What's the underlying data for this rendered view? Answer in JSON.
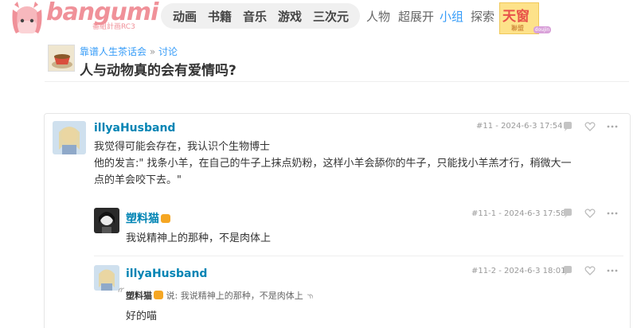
{
  "header": {
    "logo_text": "bangumi",
    "logo_sub": "番組計画RC3",
    "nav_main": [
      "动画",
      "书籍",
      "音乐",
      "游戏",
      "三次元"
    ],
    "nav_links": [
      "人物",
      "超展开",
      "小组",
      "探索"
    ],
    "active_link": "小组",
    "ad_text": "天窗",
    "ad_sub": "聯盟",
    "ad_tag": "doujin"
  },
  "topic": {
    "group_name": "靠谱人生茶话会",
    "separator": "»",
    "section": "讨论",
    "title": "人与动物真的会有爱情吗?"
  },
  "posts": [
    {
      "user": "illyaHusband",
      "meta": "#11 - 2024-6-3 17:54",
      "lines": [
        "我觉得可能会存在，我认识个生物博士",
        "他的发言:\" 找条小羊，在自己的牛子上抹点奶粉，这样小羊会舔你的牛子，只能找小羊羔才行，稍微大一",
        "点的羊会咬下去。\""
      ]
    },
    {
      "user": "塑料猫",
      "meta": "#11-1 - 2024-6-3 17:58",
      "text": "我说精神上的那种，不是肉体上"
    },
    {
      "user": "illyaHusband",
      "meta": "#11-2 - 2024-6-3 18:01",
      "quote_user": "塑料猫",
      "quote_text": "说: 我说精神上的那种，不是肉体上",
      "text": "好的喵"
    }
  ],
  "colors": {
    "link": "#0084b4",
    "accent": "#369cf8",
    "brand": "#f09199"
  }
}
